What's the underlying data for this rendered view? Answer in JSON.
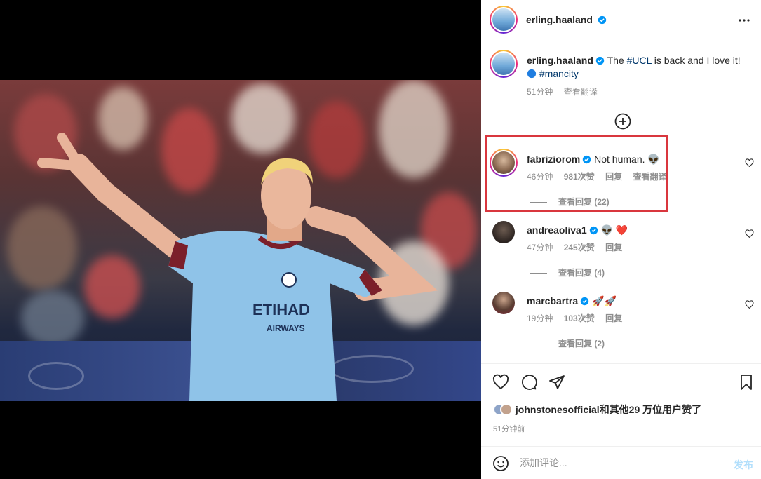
{
  "post": {
    "author": "erling.haaland",
    "caption_prefix": "The ",
    "caption_tag": "#UCL",
    "caption_suffix": " is back and I love it!",
    "caption_tag2": "#mancity",
    "caption_time": "51分钟",
    "translate_label": "查看翻译"
  },
  "comments": [
    {
      "user": "fabriziorom",
      "text": "Not human. 👽",
      "time": "46分钟",
      "likes": "981次赞",
      "reply_label": "回复",
      "translate_label": "查看翻译",
      "replies": "查看回复 (22)"
    },
    {
      "user": "andreaoliva1",
      "text": "👽 ❤️",
      "time": "47分钟",
      "likes": "245次赞",
      "reply_label": "回复",
      "replies": "查看回复 (4)"
    },
    {
      "user": "marcbartra",
      "text": "🚀🚀",
      "time": "19分钟",
      "likes": "103次赞",
      "reply_label": "回复",
      "replies": "查看回复 (2)"
    }
  ],
  "likes_summary": {
    "user": "johnstonesofficial",
    "suffix": "和其他29 万位用户赞了"
  },
  "posted_time": "51分钟前",
  "comment_box": {
    "placeholder": "添加评论...",
    "post_label": "发布"
  },
  "colors": {
    "accent_blue": "#0095f6",
    "highlight_red": "#d9363e",
    "like_red": "#ed4956"
  },
  "icons": [
    "more-icon",
    "verified-icon",
    "add-comment-icon",
    "heart-icon",
    "comment-icon",
    "share-icon",
    "bookmark-icon",
    "emoji-icon"
  ]
}
